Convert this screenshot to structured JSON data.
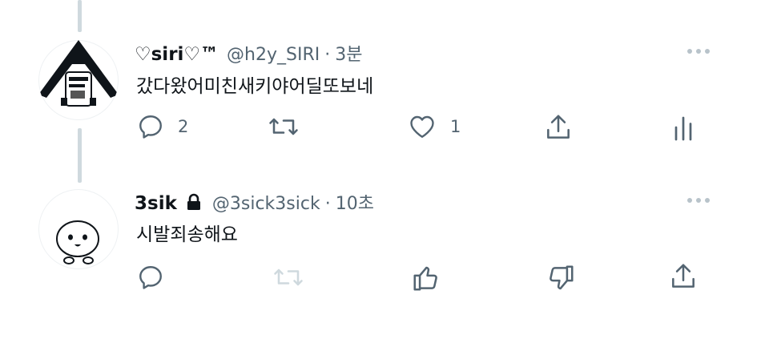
{
  "tweets": [
    {
      "display_name": "♡siri♡™",
      "handle": "@h2y_SIRI",
      "separator": "·",
      "time": "3분",
      "text": "갔다왔어미친새키야어딜또보네",
      "actions": {
        "reply": {
          "icon": "reply-icon",
          "count": "2"
        },
        "retweet": {
          "icon": "retweet-icon"
        },
        "like": {
          "icon": "heart-icon",
          "count": "1"
        },
        "share": {
          "icon": "share-icon"
        },
        "analytics": {
          "icon": "analytics-icon"
        }
      }
    },
    {
      "display_name": "3sik",
      "protected": true,
      "handle": "@3sick3sick",
      "separator": "·",
      "time": "10초",
      "text": "시발죄송해요",
      "actions": {
        "reply": {
          "icon": "reply-icon"
        },
        "retweet": {
          "icon": "retweet-icon",
          "disabled": true
        },
        "thumbs_up": {
          "icon": "thumbs-up-icon"
        },
        "thumbs_down": {
          "icon": "thumbs-down-icon"
        },
        "share": {
          "icon": "share-icon"
        }
      }
    }
  ],
  "colors": {
    "text": "#0f1419",
    "secondary": "#536471",
    "thread_line": "#cfd9de",
    "disabled_icon": "#cfd9de"
  }
}
